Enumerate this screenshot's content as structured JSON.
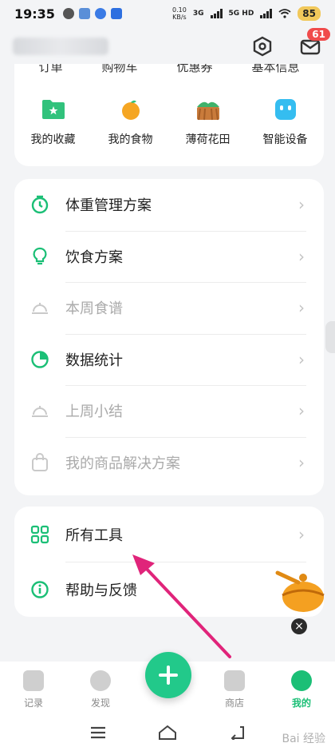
{
  "status_bar": {
    "time": "19:35",
    "net_speed_value": "0.10",
    "net_speed_unit": "KB/s",
    "signal1": "3G",
    "signal2": "5G HD",
    "battery": "85"
  },
  "header": {
    "settings_icon": "hexagon-settings-icon",
    "messages_icon": "envelope-icon",
    "message_badge": "61"
  },
  "top_card": {
    "cut_labels": [
      "订单",
      "购物车",
      "优惠券",
      "基本信息"
    ],
    "features": [
      {
        "label": "我的收藏",
        "icon": "folder-star-icon"
      },
      {
        "label": "我的食物",
        "icon": "orange-icon"
      },
      {
        "label": "薄荷花田",
        "icon": "farm-field-icon"
      },
      {
        "label": "智能设备",
        "icon": "smart-device-icon"
      }
    ]
  },
  "menu": {
    "items": [
      {
        "label": "体重管理方案",
        "icon": "timer-icon"
      },
      {
        "label": "饮食方案",
        "icon": "lightbulb-icon"
      },
      {
        "label": "本周食谱",
        "icon": "food-cover-icon"
      },
      {
        "label": "数据统计",
        "icon": "pie-chart-icon"
      },
      {
        "label": "上周小结",
        "icon": "food-cover-icon"
      },
      {
        "label": "我的商品解决方案",
        "icon": "shopping-bag-icon"
      }
    ]
  },
  "tools": {
    "items": [
      {
        "label": "所有工具",
        "icon": "grid-icon"
      },
      {
        "label": "帮助与反馈",
        "icon": "info-icon"
      }
    ]
  },
  "tabbar": {
    "tabs": [
      {
        "label": "记录"
      },
      {
        "label": "发现"
      },
      {
        "label": "商店"
      },
      {
        "label": "我的"
      }
    ],
    "fab_icon": "plus-icon"
  },
  "watermark": "Bai 经验",
  "colors": {
    "accent": "#1bbf76",
    "arrow": "#e0247a",
    "badge": "#f04b4b"
  }
}
